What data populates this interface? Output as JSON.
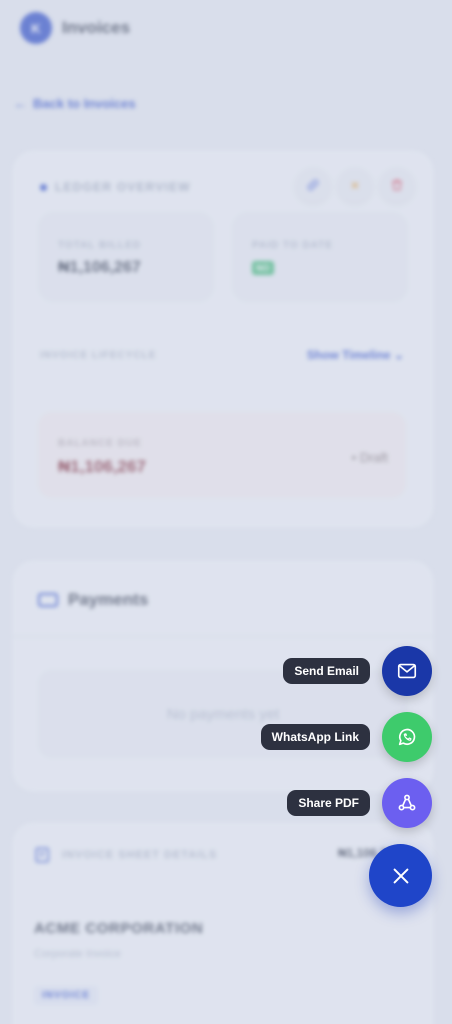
{
  "header": {
    "logo_letter": "K",
    "title": "Invoices"
  },
  "nav": {
    "back_label": "Back to Invoices"
  },
  "ledger": {
    "section_title": "LEDGER OVERVIEW",
    "total_billed_label": "TOTAL BILLED",
    "total_billed_value": "₦1,106,267",
    "paid_label": "PAID TO DATE",
    "paid_value": "NO",
    "lifecycle_label": "INVOICE LIFECYCLE",
    "timeline_link": "Show Timeline",
    "balance_label": "BALANCE DUE",
    "balance_value": "₦1,106,267",
    "status": "Draft"
  },
  "payments": {
    "title": "Payments",
    "empty_text": "No payments yet"
  },
  "sheet": {
    "title": "INVOICE SHEET DETAILS",
    "amount": "₦1,106,267",
    "company": "ACME CORPORATION",
    "company_sub": "Corporate Invoice",
    "badge": "INVOICE"
  },
  "fab_menu": {
    "send_email_label": "Send Email",
    "whatsapp_label": "WhatsApp Link",
    "share_pdf_label": "Share PDF",
    "colors": {
      "send_email": "#1a37a8",
      "whatsapp": "#3ecb6c",
      "share_pdf": "#6c5ff0",
      "close": "#1f45c9"
    }
  }
}
